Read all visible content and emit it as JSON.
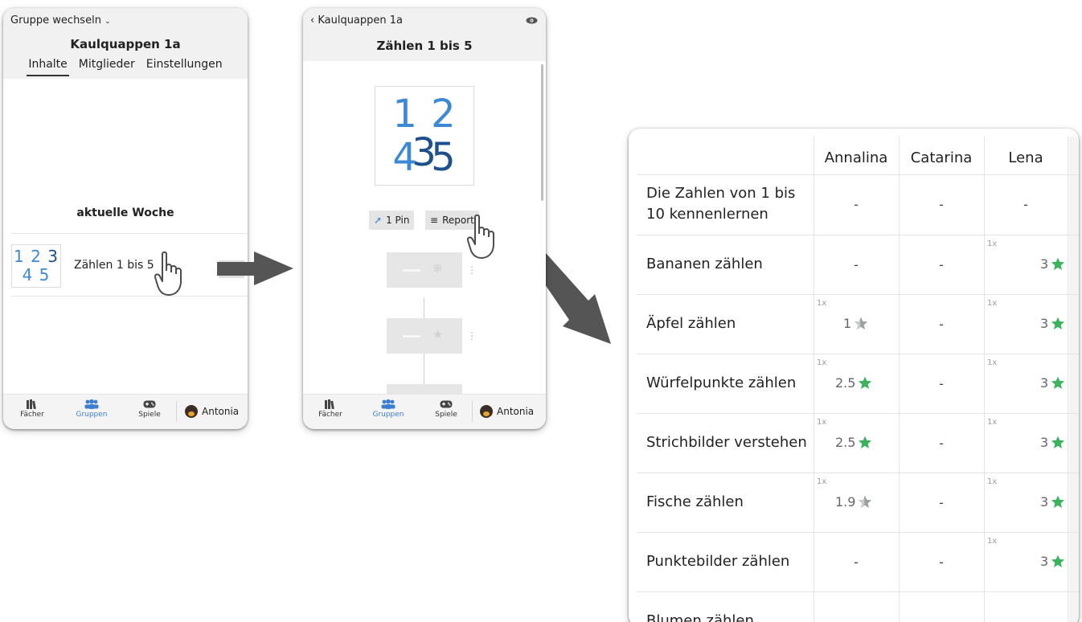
{
  "screen1": {
    "group_switch": "Gruppe wechseln",
    "title": "Kaulquappen 1a",
    "tabs": [
      "Inhalte",
      "Mitglieder",
      "Einstellungen"
    ],
    "section_title": "aktuelle Woche",
    "thumb_digits": [
      "1",
      "2",
      "3",
      "4",
      "5"
    ],
    "item_title": "Zählen 1 bis 5",
    "nav": {
      "subjects": "Fächer",
      "groups": "Gruppen",
      "games": "Spiele",
      "user": "Antonia"
    }
  },
  "screen2": {
    "back": "‹ Kaulquappen 1a",
    "title": "Zählen 1 bis 5",
    "thumb_digits": [
      "1",
      "2",
      "3",
      "4",
      "5"
    ],
    "pin_label": "1 Pin",
    "report_label": "Report",
    "nav": {
      "subjects": "Fächer",
      "groups": "Gruppen",
      "games": "Spiele",
      "user": "Antonia"
    }
  },
  "report": {
    "columns": [
      "Annalina",
      "Catarina",
      "Lena"
    ],
    "rows": [
      {
        "label": "Die Zahlen von 1 bis 10 kennenlernen",
        "cells": [
          {
            "v": "-"
          },
          {
            "v": "-"
          },
          {
            "v": "-"
          }
        ]
      },
      {
        "label": "Bananen zählen",
        "cells": [
          {
            "v": "-"
          },
          {
            "v": "-"
          },
          {
            "v": "3",
            "count": "1x",
            "star": "full"
          }
        ]
      },
      {
        "label": "Äpfel zählen",
        "cells": [
          {
            "v": "1",
            "count": "1x",
            "star": "partial"
          },
          {
            "v": "-"
          },
          {
            "v": "3",
            "count": "1x",
            "star": "full"
          }
        ]
      },
      {
        "label": "Würfelpunkte zählen",
        "cells": [
          {
            "v": "2.5",
            "count": "1x",
            "star": "full"
          },
          {
            "v": "-"
          },
          {
            "v": "3",
            "count": "1x",
            "star": "full"
          }
        ]
      },
      {
        "label": "Strichbilder verstehen",
        "cells": [
          {
            "v": "2.5",
            "count": "1x",
            "star": "full"
          },
          {
            "v": "-"
          },
          {
            "v": "3",
            "count": "1x",
            "star": "full"
          }
        ]
      },
      {
        "label": "Fische zählen",
        "cells": [
          {
            "v": "1.9",
            "count": "1x",
            "star": "partial"
          },
          {
            "v": "-"
          },
          {
            "v": "3",
            "count": "1x",
            "star": "full"
          }
        ]
      },
      {
        "label": "Punktebilder zählen",
        "cells": [
          {
            "v": "-"
          },
          {
            "v": "-"
          },
          {
            "v": "3",
            "count": "1x",
            "star": "full"
          }
        ]
      },
      {
        "label": "Blumen zählen",
        "cells": [
          {
            "v": ""
          },
          {
            "v": ""
          },
          {
            "v": ""
          }
        ]
      }
    ],
    "colors": {
      "star_full": "#3bb35c",
      "star_partial": "#9aa29c"
    }
  },
  "icons": {
    "hand": "pointing-hand-icon",
    "arrow": "arrow-icon",
    "eye": "eye-icon",
    "pin": "pin-icon",
    "list": "list-icon",
    "books": "books-icon",
    "users": "users-icon",
    "gamepad": "gamepad-icon",
    "star": "star-icon"
  }
}
